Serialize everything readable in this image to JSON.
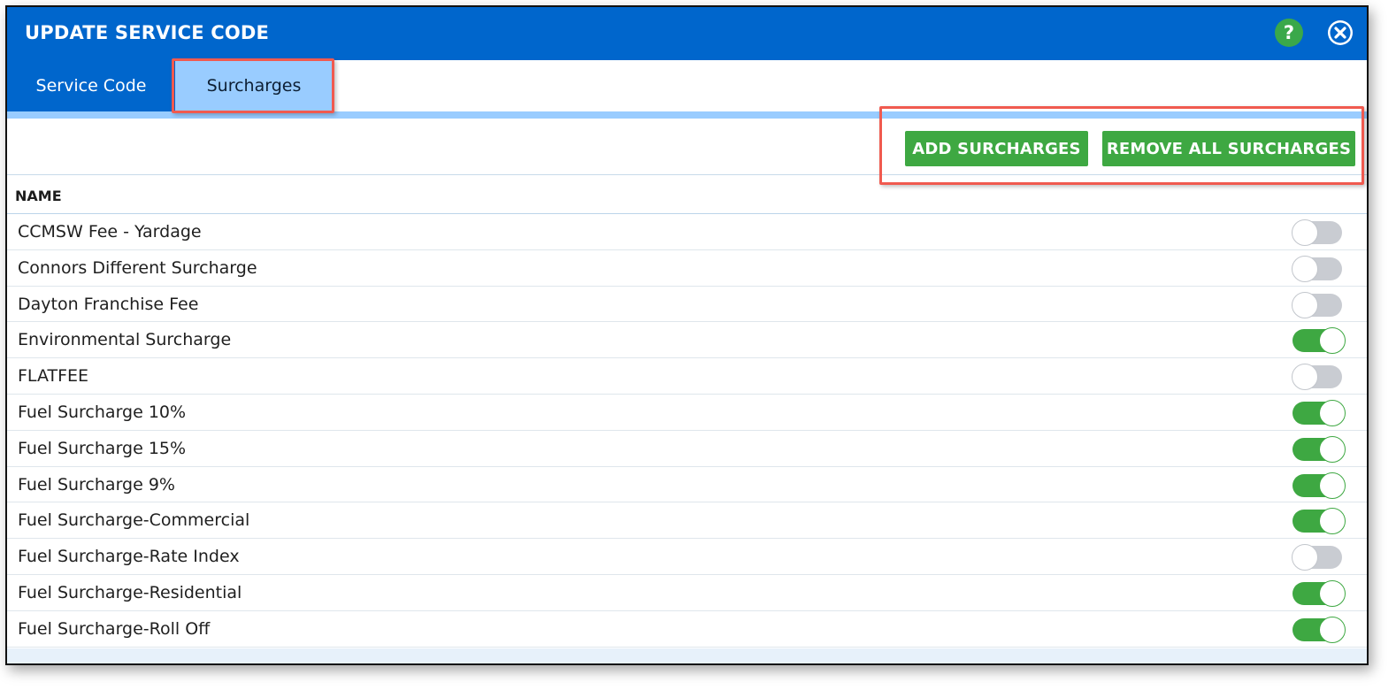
{
  "dialog": {
    "title": "UPDATE SERVICE CODE",
    "help_icon": "question-icon",
    "help_glyph": "?",
    "close_icon": "close-icon",
    "header_color": "#0066cc"
  },
  "tabs": [
    {
      "label": "Service Code",
      "active": false
    },
    {
      "label": "Surcharges",
      "active": true
    }
  ],
  "toolbar": {
    "add_label": "ADD SURCHARGES",
    "remove_label": "REMOVE ALL SURCHARGES",
    "button_color": "#3ea842"
  },
  "table": {
    "column_name": "NAME",
    "rows": [
      {
        "name": "CCMSW Fee - Yardage",
        "enabled": false
      },
      {
        "name": "Connors Different Surcharge",
        "enabled": false
      },
      {
        "name": "Dayton Franchise Fee",
        "enabled": false
      },
      {
        "name": "Environmental Surcharge",
        "enabled": true
      },
      {
        "name": "FLATFEE",
        "enabled": false
      },
      {
        "name": "Fuel Surcharge 10%",
        "enabled": true
      },
      {
        "name": "Fuel Surcharge 15%",
        "enabled": true
      },
      {
        "name": "Fuel Surcharge 9%",
        "enabled": true
      },
      {
        "name": "Fuel Surcharge-Commercial",
        "enabled": true
      },
      {
        "name": "Fuel Surcharge-Rate Index",
        "enabled": false
      },
      {
        "name": "Fuel Surcharge-Residential",
        "enabled": true
      },
      {
        "name": "Fuel Surcharge-Roll Off",
        "enabled": true
      }
    ]
  },
  "annotation_color": "#f05a4f"
}
